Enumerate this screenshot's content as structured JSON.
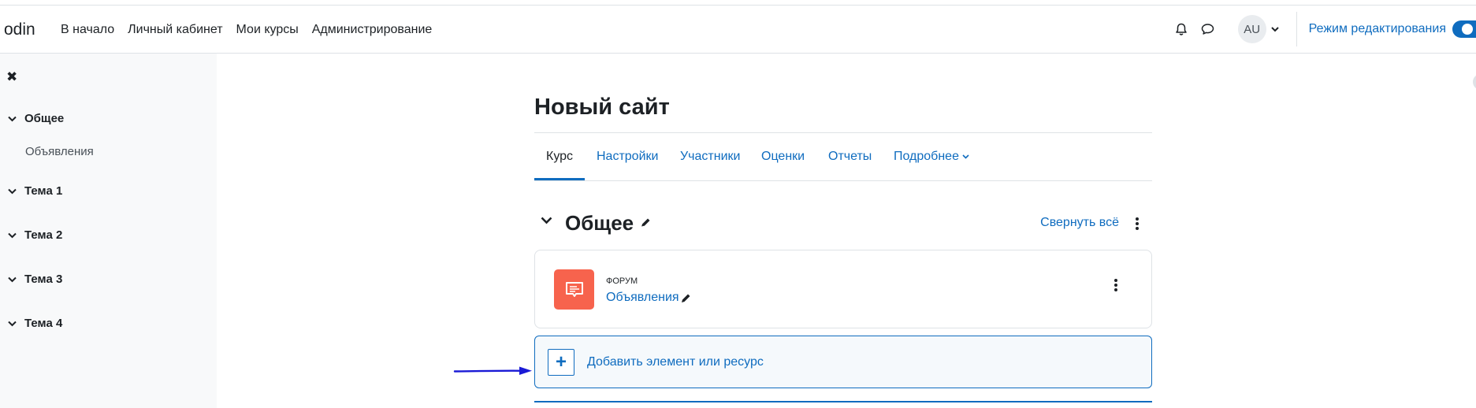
{
  "navbar": {
    "brand": "odin",
    "links": [
      "В начало",
      "Личный кабинет",
      "Мои курсы",
      "Администрирование"
    ],
    "avatar_initials": "AU",
    "edit_mode_label": "Режим редактирования",
    "edit_mode_on": true,
    "icons": [
      "bell-icon",
      "chat-icon",
      "chevron-down-icon"
    ]
  },
  "drawer": {
    "close_icon": "close-icon",
    "sections": [
      {
        "label": "Общее",
        "items": [
          "Объявления"
        ]
      },
      {
        "label": "Тема 1",
        "items": []
      },
      {
        "label": "Тема 2",
        "items": []
      },
      {
        "label": "Тема 3",
        "items": []
      },
      {
        "label": "Тема 4",
        "items": []
      }
    ]
  },
  "page": {
    "title": "Новый сайт",
    "tabs": [
      "Курс",
      "Настройки",
      "Участники",
      "Оценки",
      "Отчеты",
      "Подробнее"
    ],
    "active_tab": "Курс"
  },
  "section": {
    "title": "Общее",
    "collapse_all": "Свернуть всё"
  },
  "activity": {
    "type": "ФОРУМ",
    "name": "Объявления",
    "icon": "forum-icon"
  },
  "add_activity": {
    "label": "Добавить элемент или ресурс"
  },
  "colors": {
    "accent": "#0f6cbf",
    "forum_icon_bg": "#f7634d",
    "annotation_arrow": "#1a1ad6",
    "drawer_bg": "#f8f9fa"
  }
}
